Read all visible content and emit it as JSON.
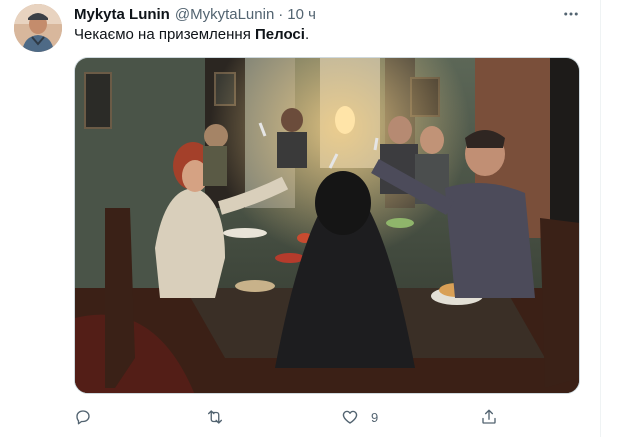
{
  "tweet": {
    "author_name": "Mykyta Lunin",
    "author_handle": "@MykytaLunin",
    "separator": "·",
    "timestamp": "10 ч",
    "text_before": "Чекаємо на приземлення ",
    "text_bold": "Пелосі",
    "text_after": ".",
    "media_icon": "photo",
    "actions": {
      "reply": {
        "icon": "reply-icon",
        "count": ""
      },
      "retweet": {
        "icon": "retweet-icon",
        "count": ""
      },
      "like": {
        "icon": "heart-icon",
        "count": "9"
      },
      "share": {
        "icon": "share-icon",
        "count": ""
      }
    }
  },
  "colors": {
    "text_primary": "#0f1419",
    "text_secondary": "#536471",
    "border": "#cfd9de"
  }
}
